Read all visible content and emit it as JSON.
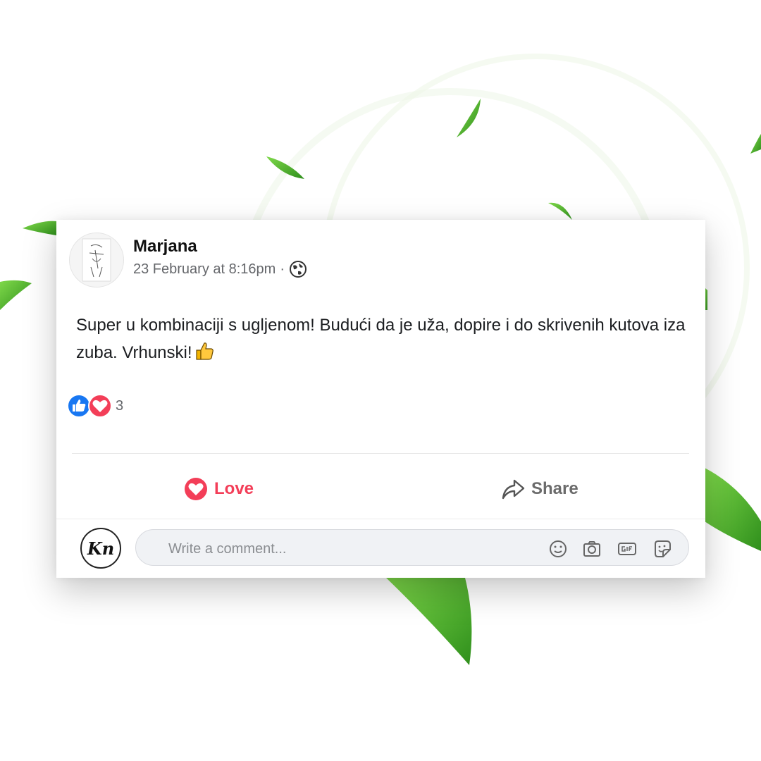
{
  "post": {
    "author": "Marjana",
    "timestamp": "23 February at 8:16pm",
    "separator": "·",
    "privacy_icon": "globe-icon",
    "text": "Super u kombinaciji s ugljenom! Budući da je uža, dopire i do skrivenih kutova iza zuba. Vrhunski!",
    "emoji": "thumbs-up-emoji",
    "reactions": {
      "icons": [
        "like-reaction-icon",
        "love-reaction-icon"
      ],
      "count": "3"
    }
  },
  "actions": {
    "love_label": "Love",
    "share_label": "Share"
  },
  "comment": {
    "avatar_text": "Kn",
    "placeholder": "Write a comment...",
    "icons": [
      "emoji-icon",
      "camera-icon",
      "gif-icon",
      "sticker-icon"
    ]
  },
  "colors": {
    "love": "#f33e58",
    "like": "#1877f2",
    "leaf": "#4caf2a",
    "text": "#1c1e21",
    "muted": "#65676b"
  }
}
